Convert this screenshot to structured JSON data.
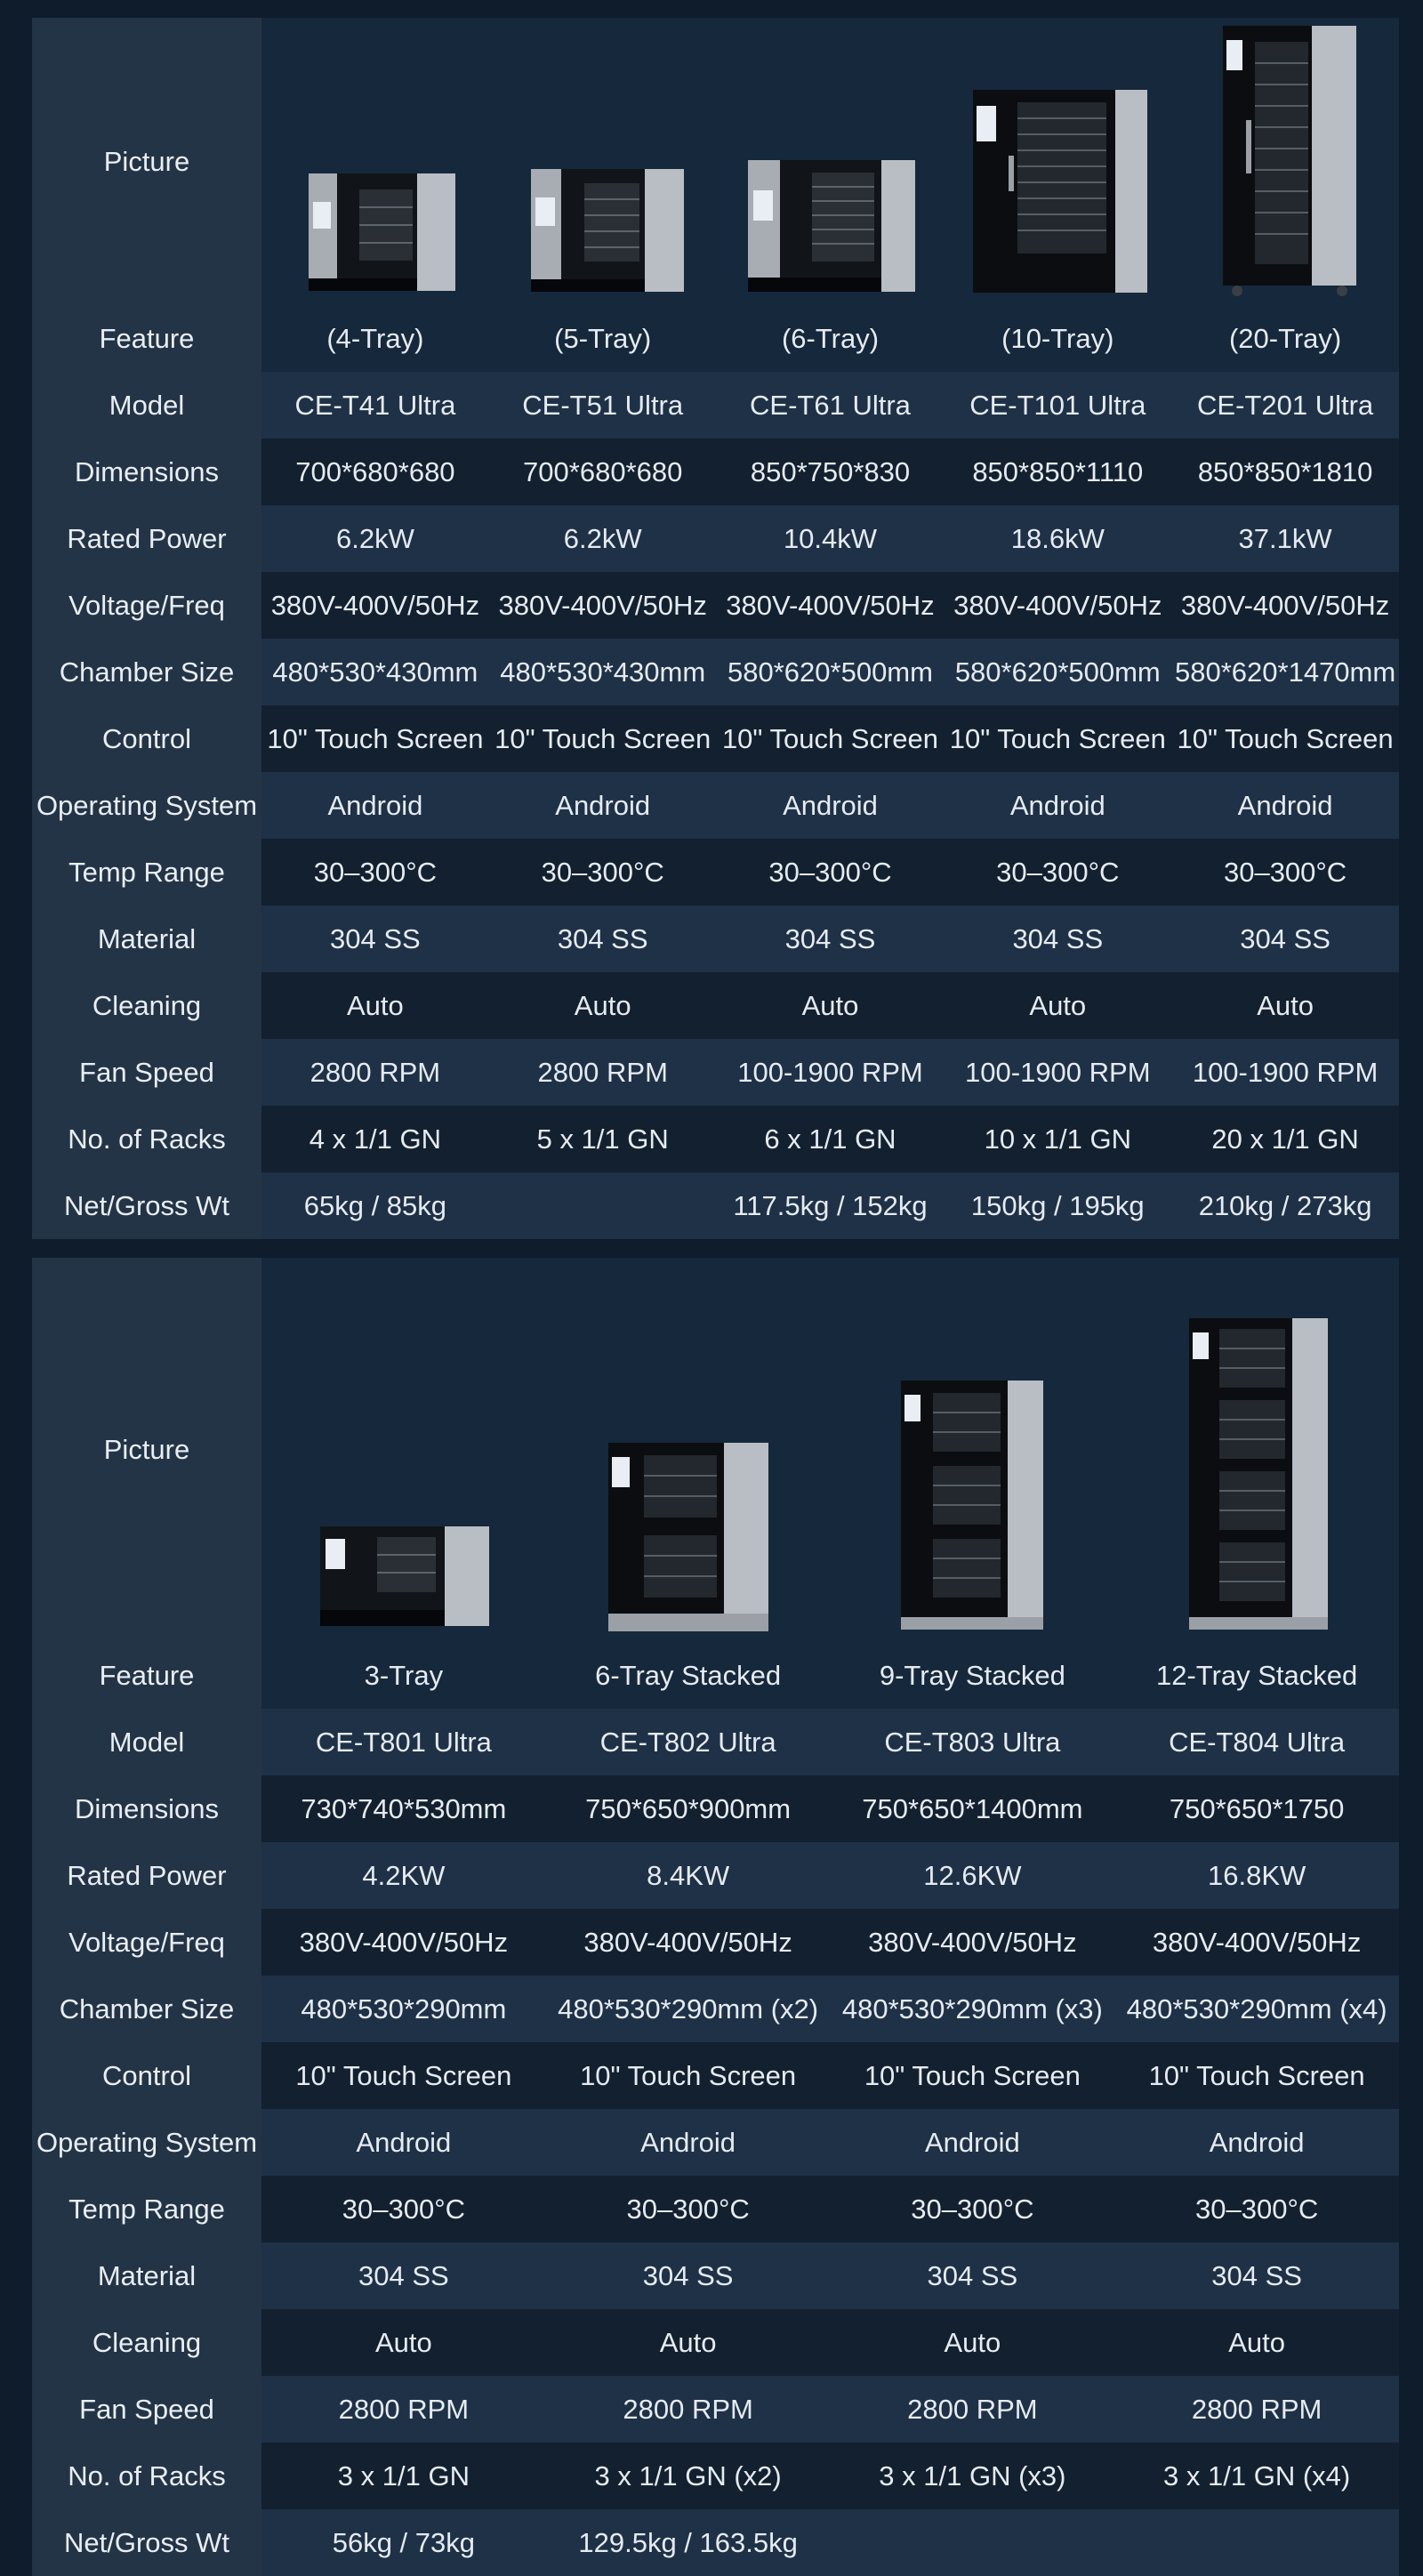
{
  "table1": {
    "labels": {
      "picture": "Picture",
      "feature": "Feature",
      "model": "Model",
      "dimensions": "Dimensions",
      "rated_power": "Rated Power",
      "voltage": "Voltage/Freq",
      "chamber": "Chamber Size",
      "control": "Control",
      "os": "Operating System",
      "temp": "Temp Range",
      "material": "Material",
      "cleaning": "Cleaning",
      "fan": "Fan Speed",
      "racks": "No. of Racks",
      "weight": "Net/Gross Wt"
    },
    "columns": [
      {
        "feature": "(4-Tray)",
        "model": "CE-T41 Ultra",
        "dimensions": "700*680*680",
        "rated_power": "6.2kW",
        "voltage": "380V-400V/50Hz",
        "chamber": "480*530*430mm",
        "control": "10\" Touch Screen",
        "os": "Android",
        "temp": "30–300°C",
        "material": "304 SS",
        "cleaning": "Auto",
        "fan": "2800 RPM",
        "racks": "4 x 1/1 GN",
        "weight": "65kg / 85kg"
      },
      {
        "feature": "(5-Tray)",
        "model": "CE-T51 Ultra",
        "dimensions": "700*680*680",
        "rated_power": "6.2kW",
        "voltage": "380V-400V/50Hz",
        "chamber": "480*530*430mm",
        "control": "10\" Touch Screen",
        "os": "Android",
        "temp": "30–300°C",
        "material": "304 SS",
        "cleaning": "Auto",
        "fan": "2800 RPM",
        "racks": "5 x 1/1 GN",
        "weight": ""
      },
      {
        "feature": "(6-Tray)",
        "model": "CE-T61 Ultra",
        "dimensions": "850*750*830",
        "rated_power": "10.4kW",
        "voltage": "380V-400V/50Hz",
        "chamber": "580*620*500mm",
        "control": "10\" Touch Screen",
        "os": "Android",
        "temp": "30–300°C",
        "material": "304 SS",
        "cleaning": "Auto",
        "fan": "100-1900 RPM",
        "racks": "6 x 1/1 GN",
        "weight": "117.5kg / 152kg"
      },
      {
        "feature": "(10-Tray)",
        "model": "CE-T101 Ultra",
        "dimensions": "850*850*1110",
        "rated_power": "18.6kW",
        "voltage": "380V-400V/50Hz",
        "chamber": "580*620*500mm",
        "control": "10\" Touch Screen",
        "os": "Android",
        "temp": "30–300°C",
        "material": "304 SS",
        "cleaning": "Auto",
        "fan": "100-1900 RPM",
        "racks": "10 x 1/1 GN",
        "weight": "150kg / 195kg"
      },
      {
        "feature": "(20-Tray)",
        "model": "CE-T201 Ultra",
        "dimensions": "850*850*1810",
        "rated_power": "37.1kW",
        "voltage": "380V-400V/50Hz",
        "chamber": "580*620*1470mm",
        "control": "10\" Touch Screen",
        "os": "Android",
        "temp": "30–300°C",
        "material": "304 SS",
        "cleaning": "Auto",
        "fan": "100-1900 RPM",
        "racks": "20 x 1/1 GN",
        "weight": "210kg / 273kg"
      }
    ]
  },
  "table2": {
    "labels": {
      "picture": "Picture",
      "feature": "Feature",
      "model": "Model",
      "dimensions": "Dimensions",
      "rated_power": "Rated Power",
      "voltage": "Voltage/Freq",
      "chamber": "Chamber Size",
      "control": "Control",
      "os": "Operating System",
      "temp": "Temp Range",
      "material": "Material",
      "cleaning": "Cleaning",
      "fan": "Fan Speed",
      "racks": "No. of Racks",
      "weight": "Net/Gross Wt"
    },
    "columns": [
      {
        "feature": "3-Tray",
        "model": "CE-T801 Ultra",
        "dimensions": "730*740*530mm",
        "rated_power": "4.2KW",
        "voltage": "380V-400V/50Hz",
        "chamber": "480*530*290mm",
        "control": "10\" Touch Screen",
        "os": "Android",
        "temp": "30–300°C",
        "material": "304 SS",
        "cleaning": "Auto",
        "fan": "2800 RPM",
        "racks": "3 x 1/1 GN",
        "weight": "56kg / 73kg"
      },
      {
        "feature": "6-Tray Stacked",
        "model": "CE-T802 Ultra",
        "dimensions": "750*650*900mm",
        "rated_power": "8.4KW",
        "voltage": "380V-400V/50Hz",
        "chamber": "480*530*290mm (x2)",
        "control": "10\" Touch Screen",
        "os": "Android",
        "temp": "30–300°C",
        "material": "304 SS",
        "cleaning": "Auto",
        "fan": "2800 RPM",
        "racks": "3 x 1/1 GN (x2)",
        "weight": "129.5kg / 163.5kg"
      },
      {
        "feature": "9-Tray Stacked",
        "model": "CE-T803 Ultra",
        "dimensions": "750*650*1400mm",
        "rated_power": "12.6KW",
        "voltage": "380V-400V/50Hz",
        "chamber": "480*530*290mm (x3)",
        "control": "10\" Touch Screen",
        "os": "Android",
        "temp": "30–300°C",
        "material": "304 SS",
        "cleaning": "Auto",
        "fan": "2800 RPM",
        "racks": "3 x 1/1 GN (x3)",
        "weight": ""
      },
      {
        "feature": "12-Tray Stacked",
        "model": "CE-T804 Ultra",
        "dimensions": "750*650*1750",
        "rated_power": "16.8KW",
        "voltage": "380V-400V/50Hz",
        "chamber": "480*530*290mm (x4)",
        "control": "10\" Touch Screen",
        "os": "Android",
        "temp": "30–300°C",
        "material": "304 SS",
        "cleaning": "Auto",
        "fan": "2800 RPM",
        "racks": "3 x 1/1 GN (x4)",
        "weight": ""
      }
    ]
  },
  "colors": {
    "background": "#0f1c2c",
    "label_cell": "#243447",
    "row_light": "#1e3147",
    "row_dark": "#13202f",
    "oven_steel": "#b9bec4",
    "oven_glass": "#111418"
  },
  "icons": {
    "oven": "combi-oven-image"
  }
}
